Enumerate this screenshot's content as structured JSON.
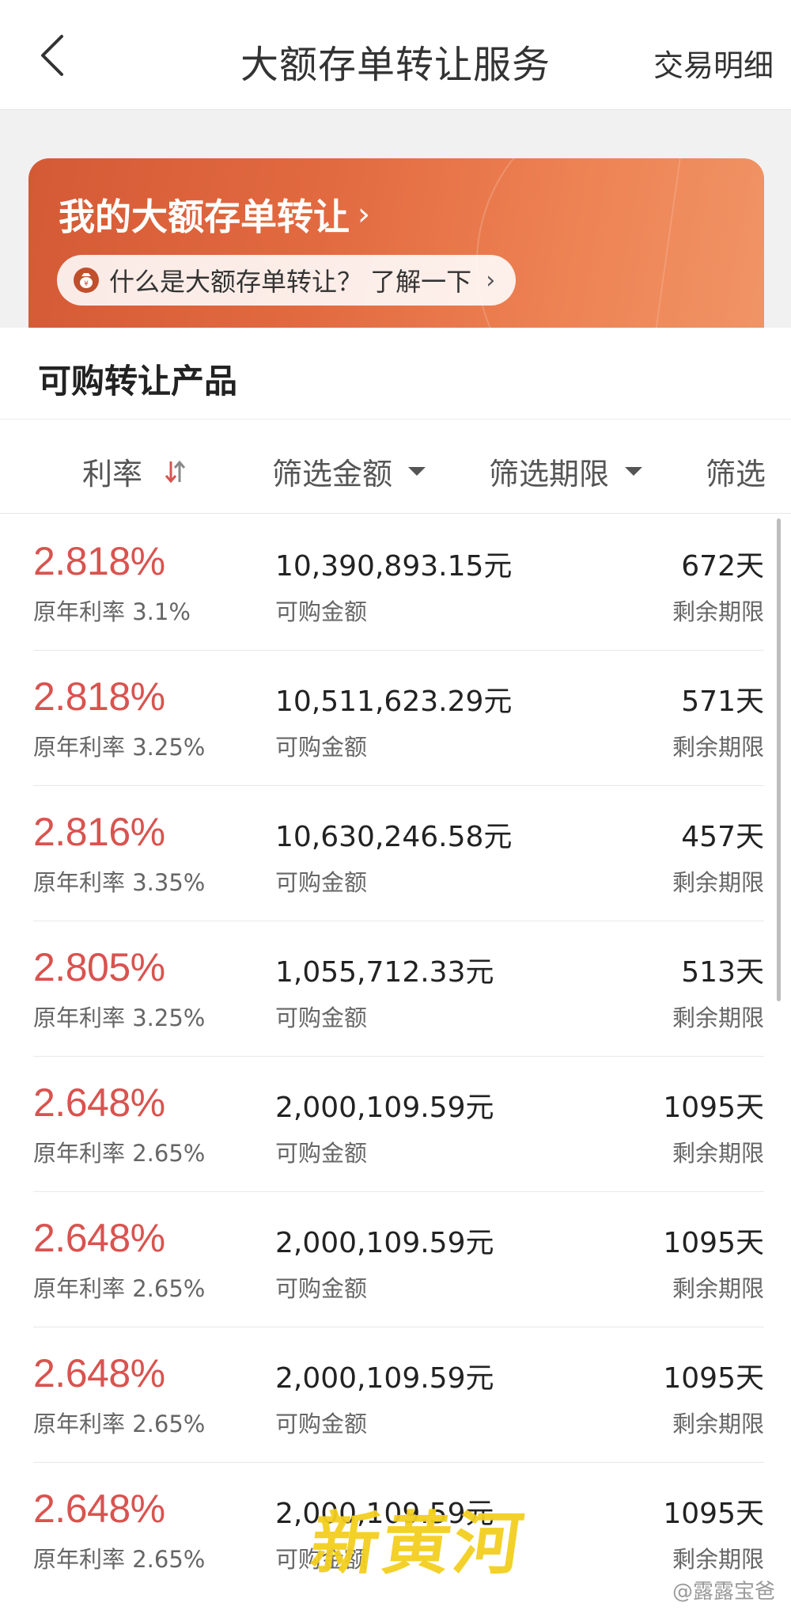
{
  "header": {
    "title": "大额存单转让服务",
    "right_link": "交易明细"
  },
  "banner": {
    "title": "我的大额存单转让",
    "title_chevron": "›",
    "pill_text": "什么是大额存单转让？ 了解一下",
    "pill_chevron": "›"
  },
  "section": {
    "title": "可购转让产品"
  },
  "filters": {
    "rate": "利率",
    "amount": "筛选金额",
    "term": "筛选期限",
    "more": "筛选"
  },
  "list": [
    {
      "rate": "2.818%",
      "orig": "原年利率 3.1%",
      "amount": "10,390,893.15元",
      "amount_label": "可购金额",
      "days": "672天",
      "days_label": "剩余期限"
    },
    {
      "rate": "2.818%",
      "orig": "原年利率 3.25%",
      "amount": "10,511,623.29元",
      "amount_label": "可购金额",
      "days": "571天",
      "days_label": "剩余期限"
    },
    {
      "rate": "2.816%",
      "orig": "原年利率 3.35%",
      "amount": "10,630,246.58元",
      "amount_label": "可购金额",
      "days": "457天",
      "days_label": "剩余期限"
    },
    {
      "rate": "2.805%",
      "orig": "原年利率 3.25%",
      "amount": "1,055,712.33元",
      "amount_label": "可购金额",
      "days": "513天",
      "days_label": "剩余期限"
    },
    {
      "rate": "2.648%",
      "orig": "原年利率 2.65%",
      "amount": "2,000,109.59元",
      "amount_label": "可购金额",
      "days": "1095天",
      "days_label": "剩余期限"
    },
    {
      "rate": "2.648%",
      "orig": "原年利率 2.65%",
      "amount": "2,000,109.59元",
      "amount_label": "可购金额",
      "days": "1095天",
      "days_label": "剩余期限"
    },
    {
      "rate": "2.648%",
      "orig": "原年利率 2.65%",
      "amount": "2,000,109.59元",
      "amount_label": "可购金额",
      "days": "1095天",
      "days_label": "剩余期限"
    },
    {
      "rate": "2.648%",
      "orig": "原年利率 2.65%",
      "amount": "2,000,109.59元",
      "amount_label": "可购金额",
      "days": "1095天",
      "days_label": "剩余期限"
    }
  ],
  "watermark": {
    "logo_text": "新黄河",
    "handle": "@露露宝爸"
  },
  "colors": {
    "rate_red": "#d9534f",
    "banner_start": "#d45a36",
    "banner_end": "#f09466"
  }
}
